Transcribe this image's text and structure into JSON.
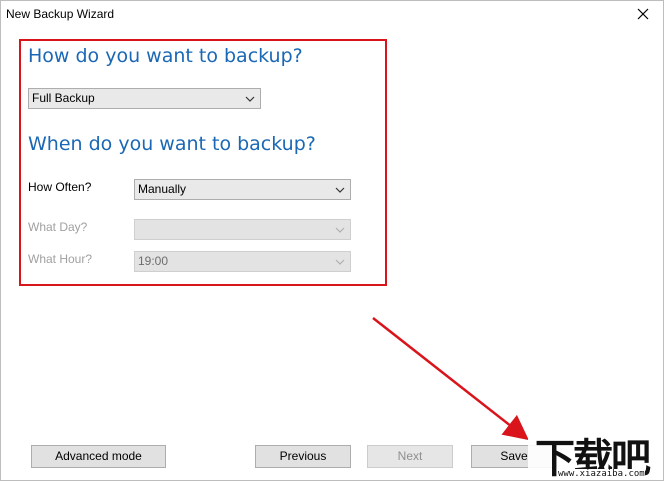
{
  "window": {
    "title": "New Backup Wizard"
  },
  "backup_type": {
    "heading": "How do you want to backup?",
    "selected": "Full Backup"
  },
  "schedule": {
    "heading": "When do you want to backup?",
    "how_often_label": "How Often?",
    "how_often_value": "Manually",
    "what_day_label": "What Day?",
    "what_day_value": "",
    "what_hour_label": "What Hour?",
    "what_hour_value": "19:00"
  },
  "buttons": {
    "advanced_mode": "Advanced mode",
    "previous": "Previous",
    "next": "Next",
    "save": "Save"
  },
  "annotation": {
    "highlight_color": "#d9141b",
    "arrow_color": "#d9141b"
  },
  "watermark": {
    "logo_text": "下载吧",
    "url": "www.xiazaiba.com"
  },
  "icons": {
    "close": "close-icon",
    "dropdown": "chevron-down-icon"
  }
}
